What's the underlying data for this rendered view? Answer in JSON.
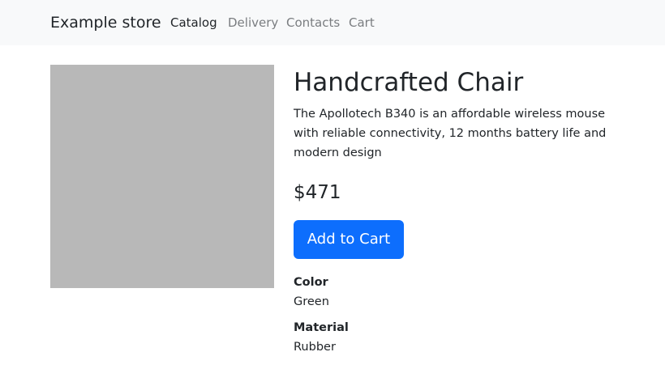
{
  "navbar": {
    "brand": "Example store",
    "links": [
      {
        "label": "Catalog",
        "active": true
      },
      {
        "label": "Delivery",
        "active": false
      },
      {
        "label": "Contacts",
        "active": false
      },
      {
        "label": "Cart",
        "active": false
      }
    ]
  },
  "product": {
    "title": "Handcrafted Chair",
    "description": "The Apollotech B340 is an affordable wireless mouse with reliable connectivity, 12 months battery life and modern design",
    "price": "$471",
    "add_to_cart_label": "Add to Cart",
    "attributes": [
      {
        "label": "Color",
        "value": "Green"
      },
      {
        "label": "Material",
        "value": "Rubber"
      }
    ]
  },
  "colors": {
    "navbar_bg": "#f8f9fa",
    "primary_button": "#0d6efd",
    "image_placeholder": "#b8b8b8",
    "text": "#212529",
    "nav_inactive": "#7a7d80"
  }
}
